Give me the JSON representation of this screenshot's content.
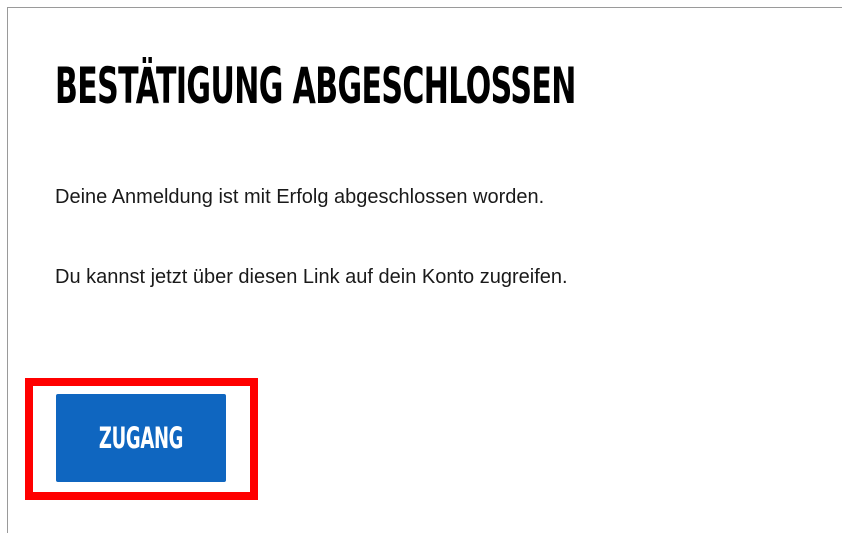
{
  "confirmation": {
    "title": "BESTÄTIGUNG ABGESCHLOSSEN",
    "message_1": "Deine Anmeldung ist mit Erfolg abgeschlossen worden.",
    "message_2": "Du kannst jetzt über diesen Link auf dein Konto zugreifen.",
    "access_button_label": "ZUGANG"
  },
  "colors": {
    "button_background": "#0f66c0",
    "button_text": "#ffffff",
    "highlight_border": "#ff0000",
    "title_text": "#000000"
  }
}
